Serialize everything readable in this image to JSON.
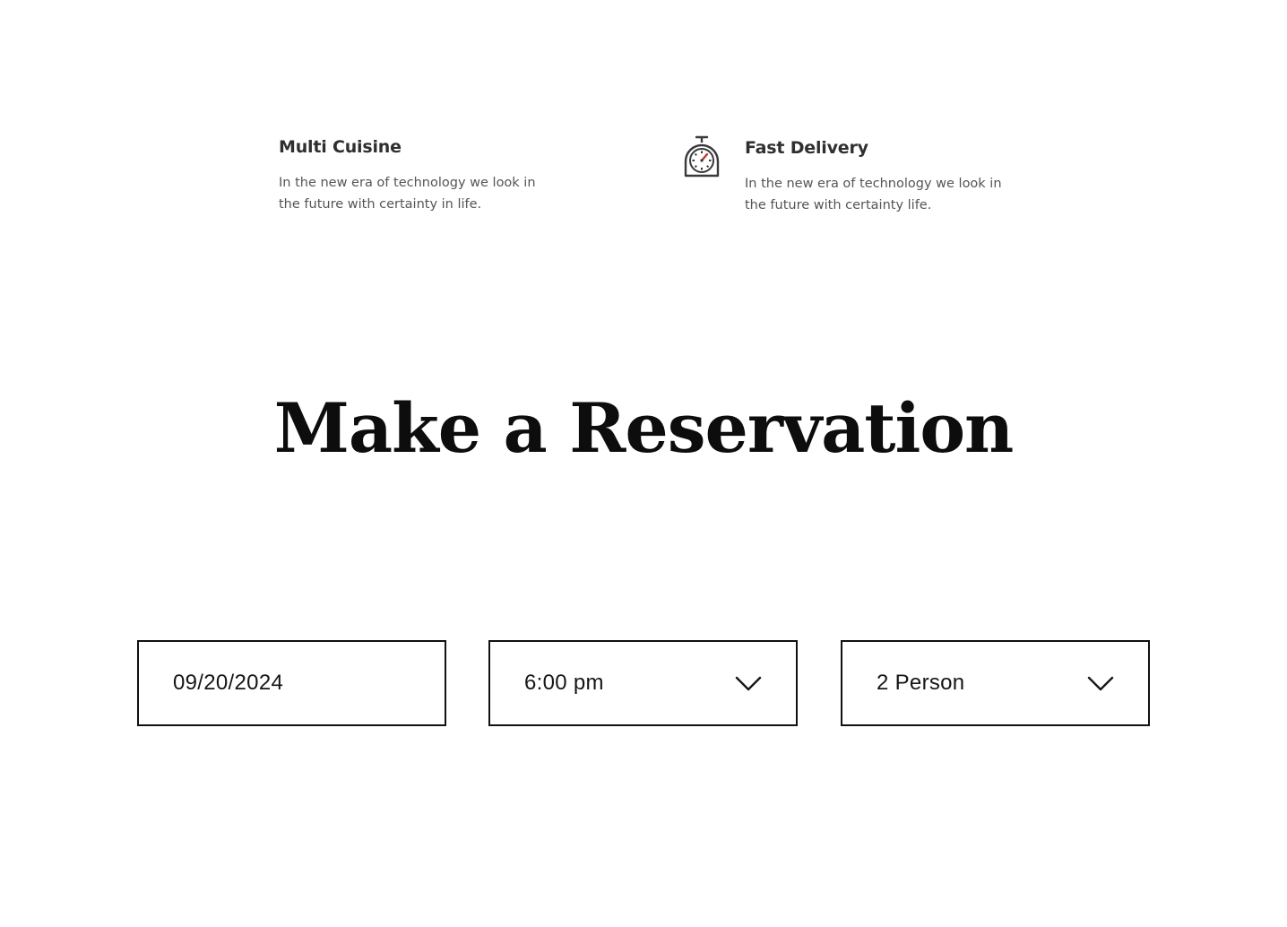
{
  "features": [
    {
      "title": "Multi Cuisine",
      "description": "In the new era of technology we look in the future with certainty in life.",
      "icon": ""
    },
    {
      "title": "Fast Delivery",
      "description": "In the new era of technology we look in the future with certainty life.",
      "icon": "stopwatch-icon"
    }
  ],
  "reservation": {
    "heading": "Make a Reservation",
    "date_value": "09/20/2024",
    "time_value": "6:00 pm",
    "party_value": "2 Person"
  },
  "colors": {
    "text_dark": "#0d0d0d",
    "border": "#111111",
    "icon_accent": "#c0392b",
    "icon_stroke": "#3a3a3a"
  }
}
